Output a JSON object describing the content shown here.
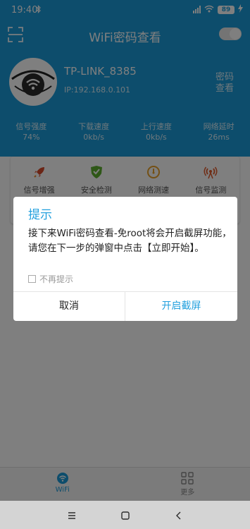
{
  "status_bar": {
    "time": "19:40",
    "battery": "89",
    "bluetooth_icon": "bluetooth-icon",
    "right_icons": [
      "hd-signal-icon",
      "wifi-icon",
      "battery-icon",
      "charging-icon"
    ]
  },
  "app": {
    "title": "WiFi密码查看",
    "scan_icon": "scan-icon",
    "toggle_state": "on",
    "wifi_name": "TP-LINK_8385",
    "ip": "IP:192.168.0.101",
    "password_view": "密码查看"
  },
  "stats": [
    {
      "label": "信号强度",
      "value": "74%"
    },
    {
      "label": "下载速度",
      "value": "0kb/s"
    },
    {
      "label": "上行速度",
      "value": "0kb/s"
    },
    {
      "label": "网络延时",
      "value": "26ms"
    }
  ],
  "tools": [
    {
      "label": "信号增强",
      "icon": "rocket-icon"
    },
    {
      "label": "安全检测",
      "icon": "shield-icon"
    },
    {
      "label": "网络测速",
      "icon": "speedometer-icon"
    },
    {
      "label": "信号监测",
      "icon": "broadcast-icon"
    }
  ],
  "bottom_nav": [
    {
      "label": "WiFi",
      "icon": "wifi-nav-icon",
      "active": true
    },
    {
      "label": "更多",
      "icon": "grid-more-icon",
      "active": false
    }
  ],
  "system_nav": [
    "menu-icon",
    "home-icon",
    "back-icon"
  ],
  "dialog": {
    "title": "提示",
    "message": "接下来WiFi密码查看-免root将会开启截屏功能，请您在下一步的弹窗中点击【立即开始】。",
    "checkbox_label": "不再提示",
    "checkbox_checked": false,
    "cancel": "取消",
    "confirm": "开启截屏"
  },
  "colors": {
    "primary": "#1a9ad8",
    "dialog_accent": "#22a0de"
  }
}
